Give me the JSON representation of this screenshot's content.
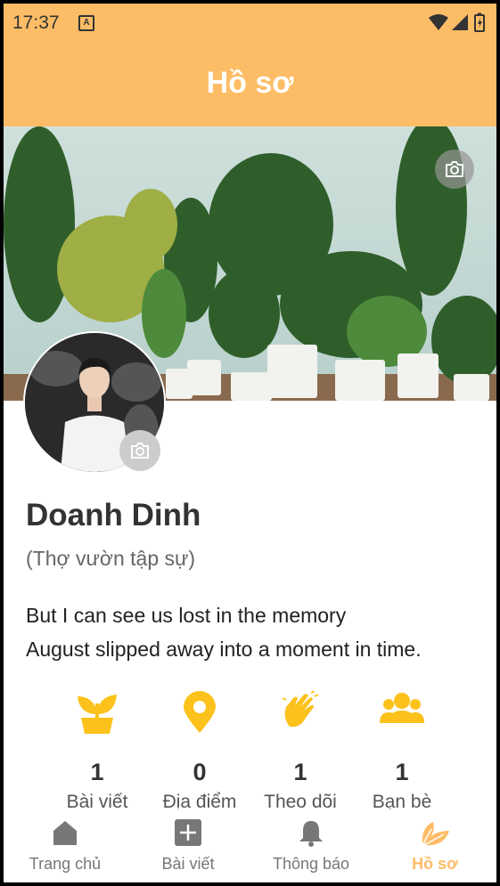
{
  "status": {
    "time": "17:37",
    "notif_badge": "A"
  },
  "header": {
    "title": "Hồ sơ"
  },
  "profile": {
    "name": "Doanh Dinh",
    "role": "(Thợ vườn tập sự)",
    "bio_line1": "But I can see us lost in the memory",
    "bio_line2": "August slipped away into a moment in time."
  },
  "stats": [
    {
      "value": "1",
      "label": "Bài viết",
      "icon": "plant-icon"
    },
    {
      "value": "0",
      "label": "Địa điểm",
      "icon": "location-pin-icon"
    },
    {
      "value": "1",
      "label": "Theo dõi",
      "icon": "waving-hand-icon"
    },
    {
      "value": "1",
      "label": "Bạn bè",
      "icon": "friends-icon"
    }
  ],
  "nav": [
    {
      "label": "Trang chủ",
      "icon": "home-icon"
    },
    {
      "label": "Bài viết",
      "icon": "add-post-icon"
    },
    {
      "label": "Thông báo",
      "icon": "bell-icon"
    },
    {
      "label": "Hồ sơ",
      "icon": "leaf-icon"
    }
  ],
  "colors": {
    "accent": "#fdbd66",
    "stat_icon": "#fcc21b",
    "text": "#333333"
  }
}
